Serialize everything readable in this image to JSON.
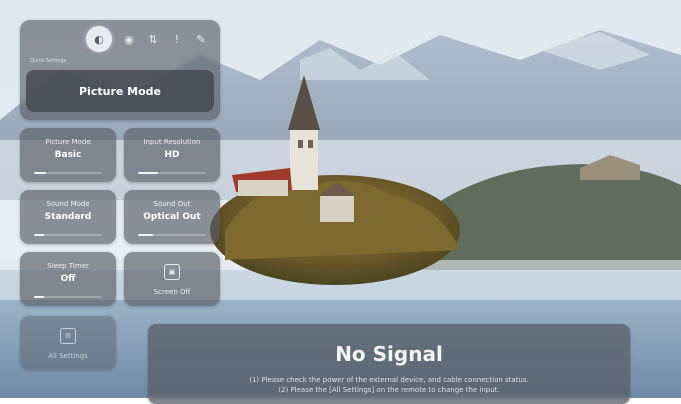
{
  "quick_settings": {
    "label": "Quick Settings",
    "icons": [
      {
        "name": "picture-icon",
        "glyph": "◐"
      },
      {
        "name": "sound-icon",
        "glyph": "◉"
      },
      {
        "name": "network-icon",
        "glyph": "⇅"
      },
      {
        "name": "info-icon",
        "glyph": "!"
      },
      {
        "name": "edit-icon",
        "glyph": "✎"
      }
    ],
    "picture_mode": "Picture Mode"
  },
  "tiles": {
    "picture_mode": {
      "title": "Picture Mode",
      "value": "Basic"
    },
    "sound_mode": {
      "title": "Sound Mode",
      "value": "Standard"
    },
    "sleep_timer": {
      "title": "Sleep Timer",
      "value": "Off"
    },
    "cast_target": {
      "title": "Sound Out",
      "value": "Optical Out"
    },
    "display_resolution": {
      "title": "Input Resolution",
      "value": "HD"
    },
    "screen_off": {
      "title": "Screen Off"
    },
    "all_settings": {
      "title": "All Settings"
    }
  },
  "no_signal": {
    "title": "No Signal",
    "line1": "(1) Please check the power of the external device, and cable connection status.",
    "line2": "(2) Please the [All Settings] on the remote to change the input."
  },
  "colors": {
    "panel": "#5a5f66",
    "selected_icon_bg": "#e9ebee"
  }
}
